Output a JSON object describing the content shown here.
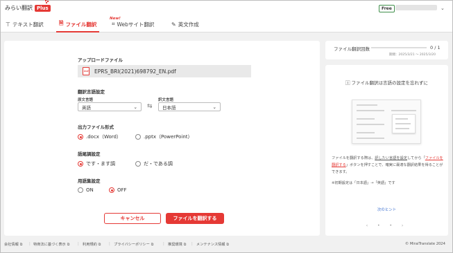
{
  "app": {
    "logo_text": "みらい翻訳",
    "logo_plus": "Plus",
    "plan": "Free"
  },
  "tabs": [
    {
      "label": "テキスト翻訳",
      "icon": "text-icon"
    },
    {
      "label": "ファイル翻訳",
      "icon": "file-icon",
      "active": true
    },
    {
      "label": "Webサイト翻訳",
      "icon": "web-icon",
      "badge": "New!"
    },
    {
      "label": "英文作成",
      "icon": "pen-icon"
    }
  ],
  "main": {
    "upload_label": "アップロードファイル",
    "file_name": "EPRS_BRI(2021)698792_EN.pdf",
    "language_label": "翻訳言語設定",
    "source_label": "原文言語",
    "source_value": "英語",
    "target_label": "訳文言語",
    "target_value": "日本語",
    "format_label": "出力ファイル形式",
    "format_options": [
      ".docx（Word）",
      ".pptx（PowerPoint）"
    ],
    "format_selected": 0,
    "style_label": "語尾調設定",
    "style_options": [
      "です・ます調",
      "だ・である調"
    ],
    "style_selected": 0,
    "glossary_label": "用語集設定",
    "glossary_options": [
      "ON",
      "OFF"
    ],
    "glossary_selected": 1,
    "cancel_label": "キャンセル",
    "translate_label": "ファイルを翻訳する"
  },
  "usage": {
    "label": "ファイル翻訳回数",
    "value": "0 / 1",
    "period": "期間：2025/3/21 ～ 2025/3/20"
  },
  "tip": {
    "title": "ファイル翻訳は言語の設定を忘れずに",
    "text_a": "ファイルを翻訳する際は、",
    "text_link": "訳したい言語を設定",
    "text_b": "してから「",
    "text_red": "ファイルを翻訳する",
    "text_c": "」ボタンを押すことで、確実に最適な翻訳結果を得ることができます。",
    "note": "※初期設定は「日本語」→「英語」です",
    "link": "次のヒント",
    "pager": "‹ • • ›"
  },
  "footer": {
    "items": [
      "会社情報",
      "特商法に基づく表示",
      "利用規約",
      "プライバシーポリシー",
      "推奨環境",
      "メンテナンス情報"
    ],
    "copyright": "© MiraiTranslate 2024"
  },
  "colors": {
    "accent": "#e53935",
    "badge_border": "#3f8f4a"
  }
}
